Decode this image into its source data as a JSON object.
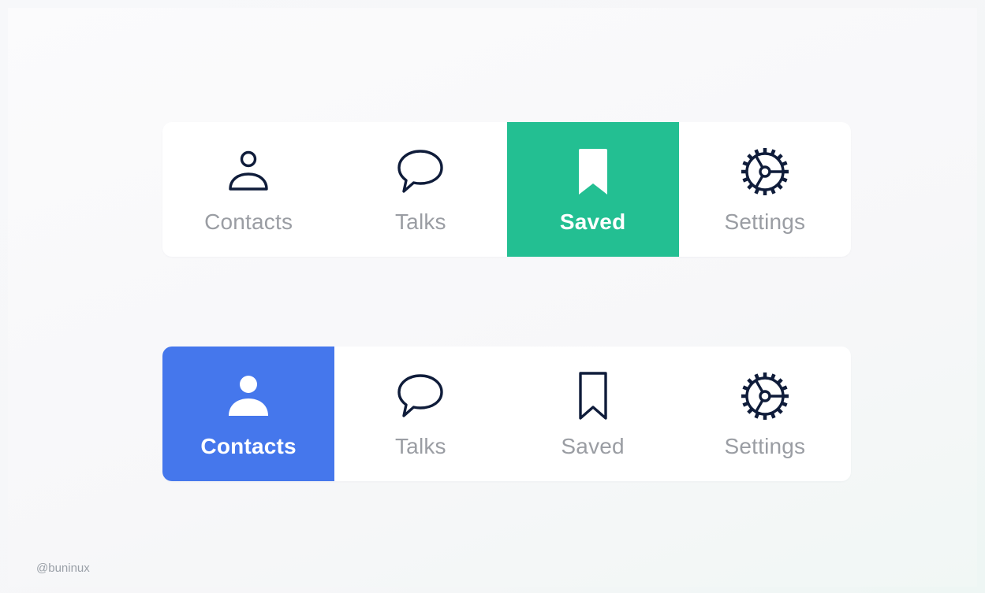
{
  "colors": {
    "active_green": "#23bf92",
    "active_blue": "#4577ec",
    "icon_dark": "#0f1c3a",
    "label_gray": "#9a9da3",
    "bar_background": "#ffffff"
  },
  "tabbars": [
    {
      "active_tab": "Saved",
      "tabs": [
        {
          "label": "Contacts",
          "icon": "user-outline-icon"
        },
        {
          "label": "Talks",
          "icon": "chat-bubble-icon"
        },
        {
          "label": "Saved",
          "icon": "bookmark-filled-icon"
        },
        {
          "label": "Settings",
          "icon": "gear-icon"
        }
      ]
    },
    {
      "active_tab": "Contacts",
      "tabs": [
        {
          "label": "Contacts",
          "icon": "user-filled-icon"
        },
        {
          "label": "Talks",
          "icon": "chat-bubble-icon"
        },
        {
          "label": "Saved",
          "icon": "bookmark-outline-icon"
        },
        {
          "label": "Settings",
          "icon": "gear-icon"
        }
      ]
    }
  ],
  "watermark": "@buninux"
}
